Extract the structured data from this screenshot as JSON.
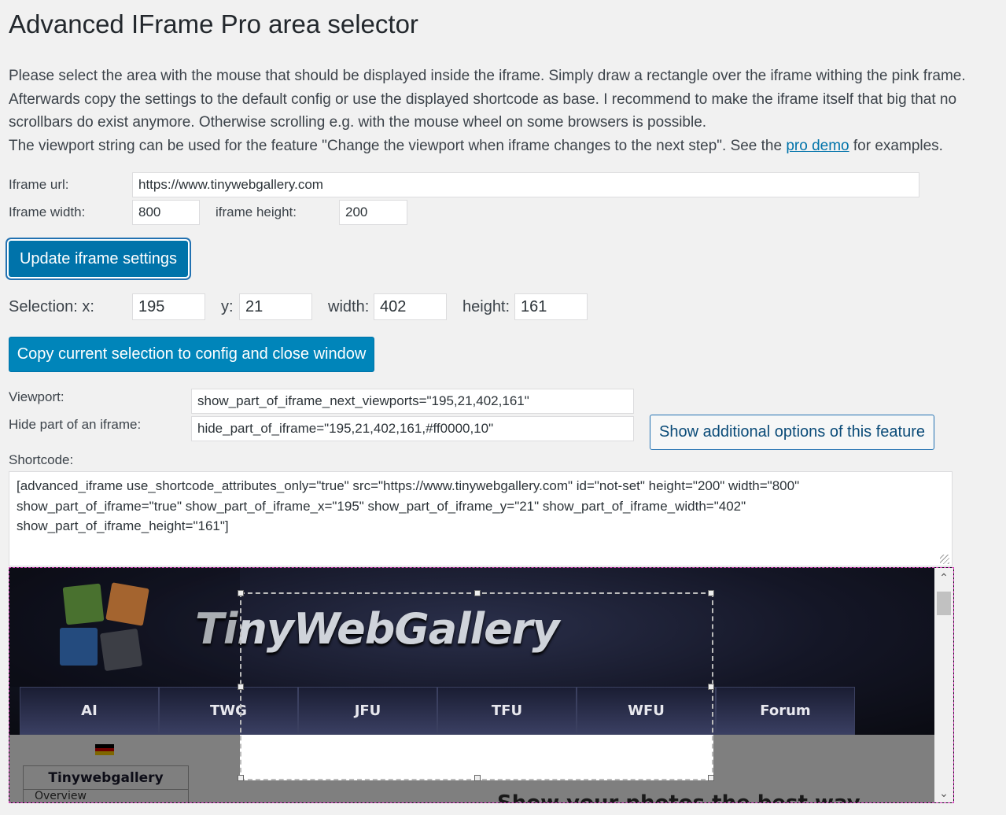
{
  "title": "Advanced IFrame Pro area selector",
  "intro": {
    "line1": "Please select the area with the mouse that should be displayed inside the iframe. Simply draw a rectangle over the iframe withing the pink frame. Afterwards copy the settings to the default config or use the displayed shortcode as base. I recommend to make the iframe itself that big that no scrollbars do exist anymore. Otherwise scrolling e.g. with the mouse wheel on some browsers is possible.",
    "line2_before": "The viewport string can be used for the feature \"Change the viewport when iframe changes to the next step\". See the ",
    "link": "pro demo",
    "line2_after": " for examples."
  },
  "form": {
    "url_label": "Iframe url:",
    "url_value": "https://www.tinywebgallery.com",
    "width_label": "Iframe width:",
    "width_value": "800",
    "height_label": "iframe height:",
    "height_value": "200",
    "update_button": "Update iframe settings"
  },
  "selection": {
    "label_x": "Selection: x:",
    "x": "195",
    "label_y": "y:",
    "y": "21",
    "label_width": "width:",
    "width": "402",
    "label_height": "height:",
    "height": "161",
    "copy_button": "Copy current selection to config and close window"
  },
  "viewport": {
    "label": "Viewport:",
    "value": "show_part_of_iframe_next_viewports=\"195,21,402,161\""
  },
  "hide": {
    "label": "Hide part of an iframe:",
    "value": "hide_part_of_iframe=\"195,21,402,161,#ff0000,10\"",
    "options_button": "Show additional options of this feature"
  },
  "shortcode": {
    "label": "Shortcode:",
    "value": "[advanced_iframe use_shortcode_attributes_only=\"true\" src=\"https://www.tinywebgallery.com\" id=\"not-set\" height=\"200\" width=\"800\" show_part_of_iframe=\"true\" show_part_of_iframe_x=\"195\" show_part_of_iframe_y=\"21\" show_part_of_iframe_width=\"402\" show_part_of_iframe_height=\"161\"]"
  },
  "preview": {
    "logo": "TinyWebGallery",
    "nav": [
      "AI",
      "TWG",
      "JFU",
      "TFU",
      "WFU",
      "Forum"
    ],
    "sidebar_title": "Tinywebgallery",
    "sidebar_sub": "Overview",
    "tagline": "Show your photos the best way"
  },
  "colors": {
    "primary": "#0085ba",
    "selection_frame": "#d63abb",
    "link": "#0073aa"
  }
}
